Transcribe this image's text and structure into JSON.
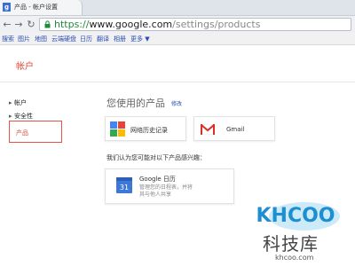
{
  "browser": {
    "tab_title": "产品 - 帐户设置",
    "favicon_letter": "g",
    "url_scheme": "https://",
    "url_host": "www.google.com",
    "url_path": "/settings/products"
  },
  "googlebar": {
    "items": [
      "搜索",
      "图片",
      "地图",
      "云端硬盘",
      "日历",
      "翻译",
      "相册",
      "更多 ▼"
    ]
  },
  "page": {
    "title": "帐户",
    "sidebar": {
      "items": [
        "帐户",
        "安全性"
      ],
      "selected": "产品"
    },
    "products_section": {
      "title": "您使用的产品",
      "edit_label": "修改",
      "products": [
        "网络历史记录",
        "Gmail"
      ]
    },
    "interest_section": {
      "title": "我们认为您可能对以下产品感兴趣：",
      "card": {
        "name": "Google 日历",
        "description": "管理您的日程表，并将其与他人共享",
        "icon_number": "31"
      }
    }
  },
  "watermark": {
    "logo_text": "KHCOO",
    "chinese": "科技库",
    "url": "khcoo.com"
  },
  "colors": {
    "accent_red": "#dd4b39",
    "link_blue": "#2a4db6",
    "url_green": "#1f8a3c"
  }
}
